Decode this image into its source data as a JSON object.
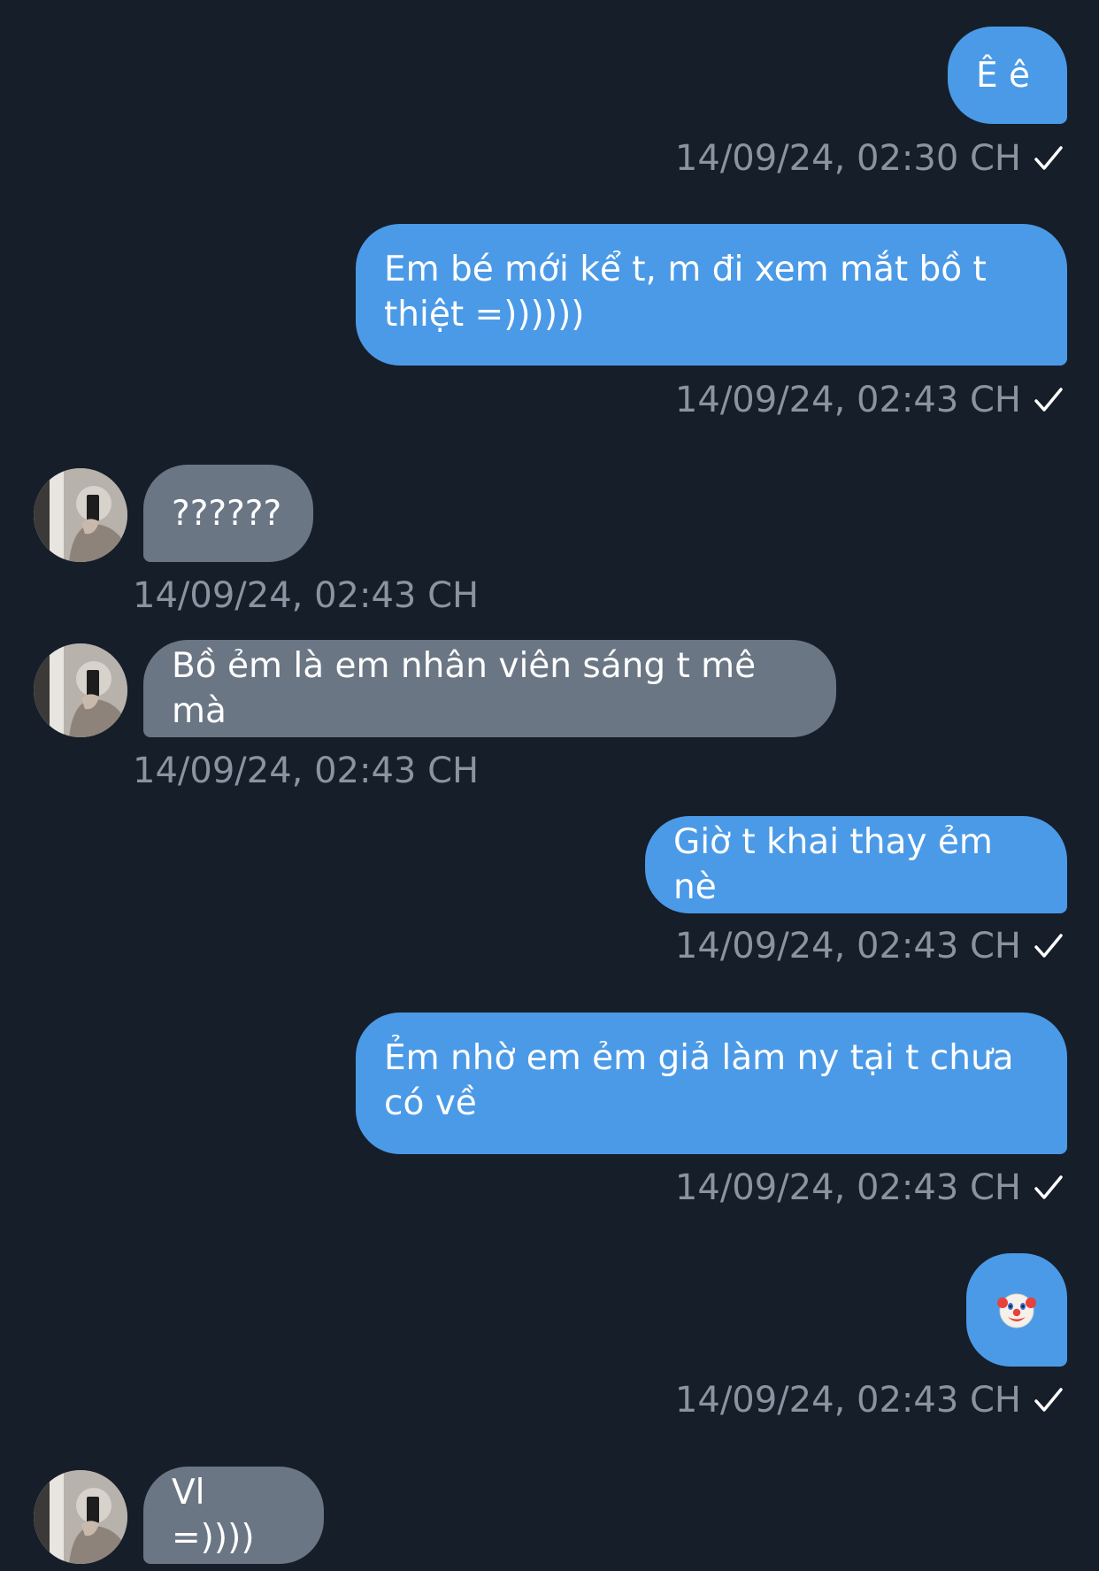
{
  "colors": {
    "background": "#161e29",
    "outgoing_bubble": "#4b9ae7",
    "incoming_bubble": "#6b7685",
    "timestamp": "#8a93a0"
  },
  "messages": [
    {
      "direction": "outgoing",
      "text": "Ê ê",
      "timestamp": "14/09/24, 02:30 CH",
      "status_icon": "check-icon"
    },
    {
      "direction": "outgoing",
      "text": "Em bé mới kể t, m đi xem mắt bồ t thiệt =))))))",
      "timestamp": "14/09/24, 02:43 CH",
      "status_icon": "check-icon"
    },
    {
      "direction": "incoming",
      "text": "??????",
      "timestamp": "14/09/24, 02:43 CH",
      "avatar": "contact-avatar"
    },
    {
      "direction": "incoming",
      "text": "Bồ ẻm là em nhân viên sáng t mê mà",
      "timestamp": "14/09/24, 02:43 CH",
      "avatar": "contact-avatar"
    },
    {
      "direction": "outgoing",
      "text": "Giờ t khai thay ẻm nè",
      "timestamp": "14/09/24, 02:43 CH",
      "status_icon": "check-icon"
    },
    {
      "direction": "outgoing",
      "text": "Ẻm nhờ em ẻm giả làm ny tại t chưa có về",
      "timestamp": "14/09/24, 02:43 CH",
      "status_icon": "check-icon"
    },
    {
      "direction": "outgoing",
      "emoji": "clown-face-emoji",
      "timestamp": "14/09/24, 02:43 CH",
      "status_icon": "check-icon"
    },
    {
      "direction": "incoming",
      "text": "Vl =))))",
      "avatar": "contact-avatar"
    }
  ]
}
